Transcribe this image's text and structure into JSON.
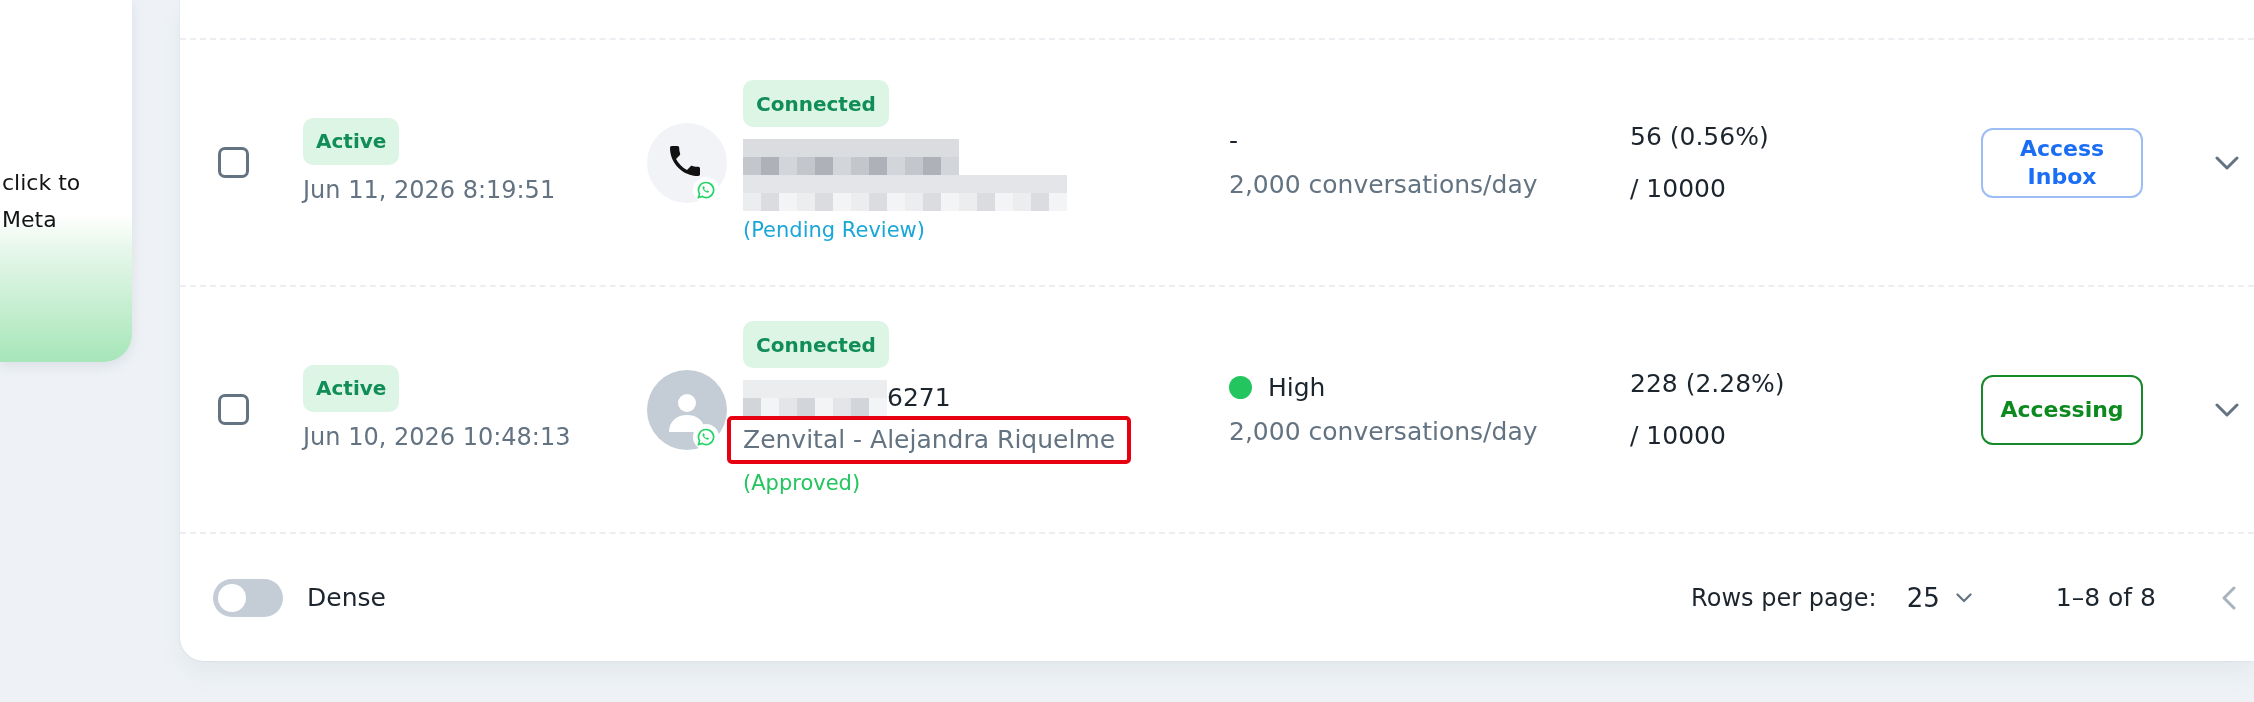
{
  "promo_card": {
    "text_lines": [
      "click to",
      "Meta"
    ]
  },
  "rows": [
    {
      "checked": false,
      "status": "Active",
      "created": "Jun 11, 2026 8:19:51",
      "avatar": {
        "kind": "phone"
      },
      "connection": "Connected",
      "number_masked": true,
      "name_masked": true,
      "highlighted": false,
      "review": {
        "label": "(Pending Review)",
        "color": "#1aa7d8"
      },
      "quality": {
        "label": "-"
      },
      "limit": "2,000 conversations/day",
      "usage": "56 (0.56%)",
      "quota": "/ 10000",
      "action": {
        "label": "Access Inbox",
        "active": false
      },
      "expanded": false
    },
    {
      "checked": false,
      "status": "Active",
      "created": "Jun 10, 2026 10:48:13",
      "avatar": {
        "kind": "person"
      },
      "connection": "Connected",
      "number_masked": true,
      "number_tail": "6271",
      "name_masked": false,
      "name": "Zenvital - Alejandra Riquelme",
      "highlighted": true,
      "review": {
        "label": "(Approved)",
        "color": "#22c55e"
      },
      "quality": {
        "label": "High",
        "color": "#22c55e"
      },
      "limit": "2,000 conversations/day",
      "usage": "228 (2.28%)",
      "quota": "/ 10000",
      "action": {
        "label": "Accessing",
        "active": true
      },
      "expanded": false
    }
  ],
  "footer": {
    "dense": {
      "label": "Dense",
      "on": false
    },
    "rows_per_page": {
      "label": "Rows per page:",
      "value": "25"
    },
    "range": "1–8 of 8",
    "prev_page": {
      "disabled": true
    }
  }
}
